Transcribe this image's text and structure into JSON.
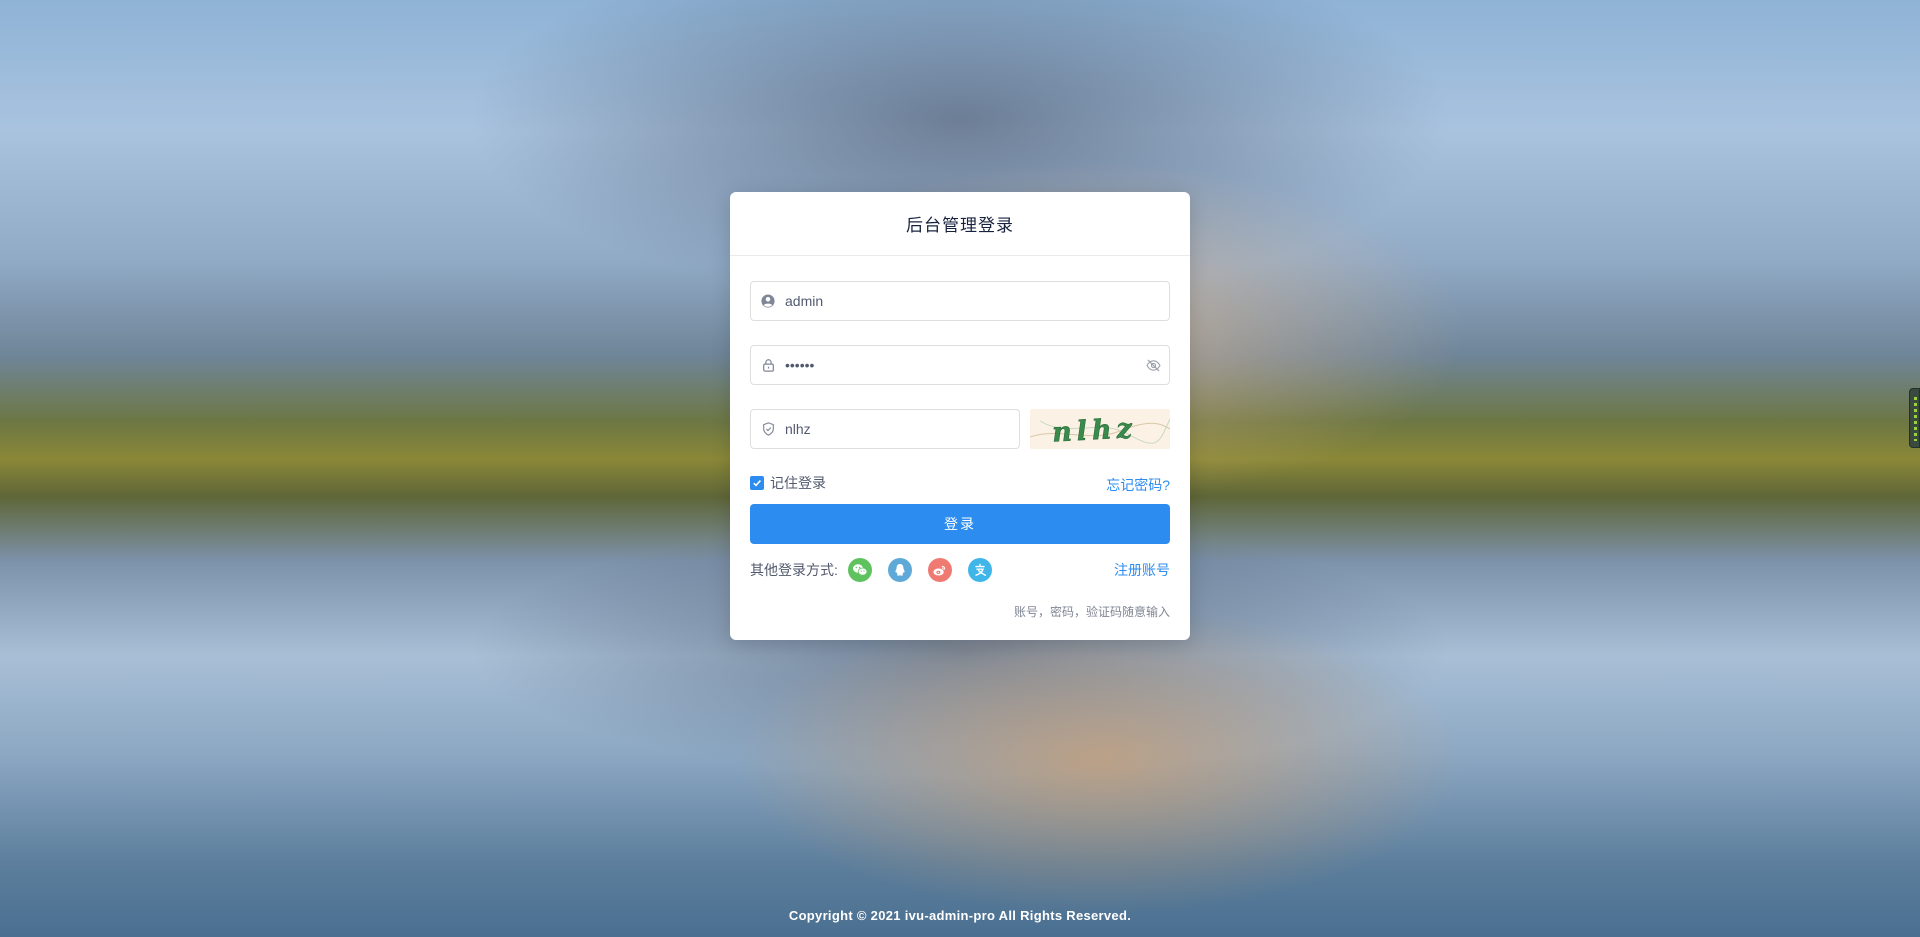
{
  "login": {
    "title": "后台管理登录",
    "username": {
      "value": "admin"
    },
    "password": {
      "value": "••••••"
    },
    "captcha": {
      "value": "nlhz",
      "image_text": "nlhz"
    },
    "remember": {
      "label": "记住登录",
      "checked": true
    },
    "forgot_label": "忘记密码?",
    "submit_label": "登录",
    "other_login_label": "其他登录方式:",
    "social_icons": [
      "wechat-icon",
      "qq-icon",
      "weibo-icon",
      "alipay-icon"
    ],
    "register_label": "注册账号",
    "hint": "账号，密码，验证码随意输入"
  },
  "footer": {
    "copyright": "Copyright © 2021 ivu-admin-pro All Rights Reserved."
  },
  "colors": {
    "primary": "#2d8cf0",
    "wechat": "#5ec25e",
    "qq": "#5fa9d8",
    "weibo": "#ef7a71",
    "alipay": "#3fb5e8"
  }
}
